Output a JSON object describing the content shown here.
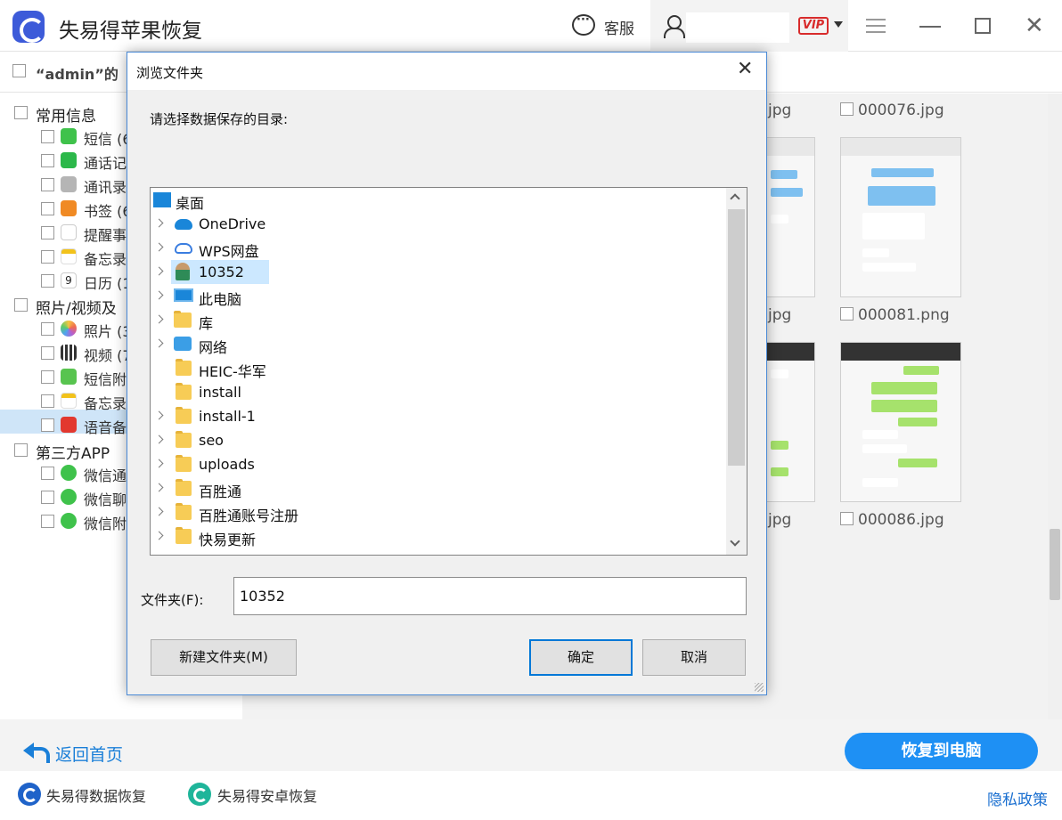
{
  "app": {
    "title": "失易得苹果恢复",
    "service_label": "客服",
    "vip_label": "VIP"
  },
  "toprow": {
    "admin_label": "“admin”的"
  },
  "sidebar": {
    "categories": [
      {
        "label": "常用信息",
        "items": [
          "短信 (6",
          "通话记",
          "通讯录",
          "书签 (6",
          "提醒事",
          "备忘录",
          "日历 (1"
        ]
      },
      {
        "label": "照片/视频及",
        "items": [
          "照片 (3",
          "视频 (7",
          "短信附",
          "备忘录",
          "语音备"
        ]
      },
      {
        "label": "第三方APP",
        "items": [
          "微信通",
          "微信聊",
          "微信附"
        ]
      }
    ]
  },
  "content": {
    "files": [
      "jpg",
      "000076.jpg",
      "jpg",
      "000081.png",
      "jpg",
      "000086.jpg"
    ]
  },
  "dialog": {
    "title": "浏览文件夹",
    "prompt": "请选择数据保存的目录:",
    "tree": [
      {
        "label": "桌面",
        "icon": "desktop-icon"
      },
      {
        "label": "OneDrive",
        "icon": "cloud-icon"
      },
      {
        "label": "WPS网盘",
        "icon": "cloud-icon"
      },
      {
        "label": "10352",
        "icon": "user-icon"
      },
      {
        "label": "此电脑",
        "icon": "computer-icon"
      },
      {
        "label": "库",
        "icon": "library-icon"
      },
      {
        "label": "网络",
        "icon": "network-icon"
      },
      {
        "label": "HEIC-华军",
        "icon": "folder-icon"
      },
      {
        "label": "install",
        "icon": "folder-icon"
      },
      {
        "label": "install-1",
        "icon": "folder-icon"
      },
      {
        "label": "seo",
        "icon": "folder-icon"
      },
      {
        "label": "uploads",
        "icon": "folder-icon"
      },
      {
        "label": "百胜通",
        "icon": "folder-icon"
      },
      {
        "label": "百胜通账号注册",
        "icon": "folder-icon"
      },
      {
        "label": "快易更新",
        "icon": "folder-icon"
      }
    ],
    "folder_label": "文件夹(F):",
    "folder_value": "10352",
    "new_folder_button": "新建文件夹(M)",
    "ok_button": "确定",
    "cancel_button": "取消"
  },
  "bottom": {
    "back_label": "返回首页",
    "recover_button": "恢复到电脑"
  },
  "footer": {
    "data_recovery": "失易得数据恢复",
    "android_recovery": "失易得安卓恢复",
    "privacy": "隐私政策"
  },
  "colors": {
    "accent": "#1e90f4",
    "link": "#1a7fd8",
    "vip": "#d82b2b",
    "selection": "#cce8ff"
  }
}
